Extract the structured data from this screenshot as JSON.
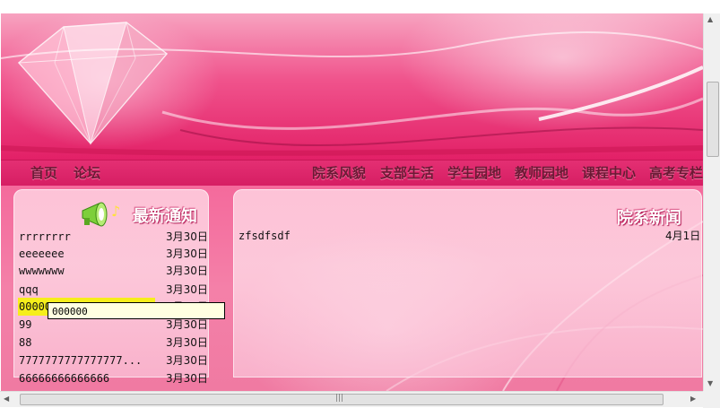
{
  "nav": {
    "left": [
      "首页",
      "论坛"
    ],
    "right": [
      "院系风貌",
      "支部生活",
      "学生园地",
      "教师园地",
      "课程中心",
      "高考专栏"
    ]
  },
  "notices": {
    "title": "最新通知",
    "items": [
      {
        "text": "rrrrrrrr",
        "date": "3月30日"
      },
      {
        "text": "eeeeeee",
        "date": "3月30日"
      },
      {
        "text": "wwwwwww",
        "date": "3月30日"
      },
      {
        "text": "qqq",
        "date": "3月30日"
      },
      {
        "text": "000000",
        "date": "3月30日",
        "highlighted": true
      },
      {
        "text": "99",
        "date": "3月30日"
      },
      {
        "text": "88",
        "date": "3月30日"
      },
      {
        "text": "7777777777777777...",
        "date": "3月30日"
      },
      {
        "text": "66666666666666",
        "date": "3月30日"
      }
    ],
    "tooltip": "000000"
  },
  "news": {
    "title": "院系新闻",
    "items": [
      {
        "text": "zfsdfsdf",
        "date": "4月1日"
      }
    ]
  },
  "colors": {
    "accent": "#e8286f",
    "highlight": "#f6ee1b",
    "tooltip_bg": "#ffffe1"
  }
}
